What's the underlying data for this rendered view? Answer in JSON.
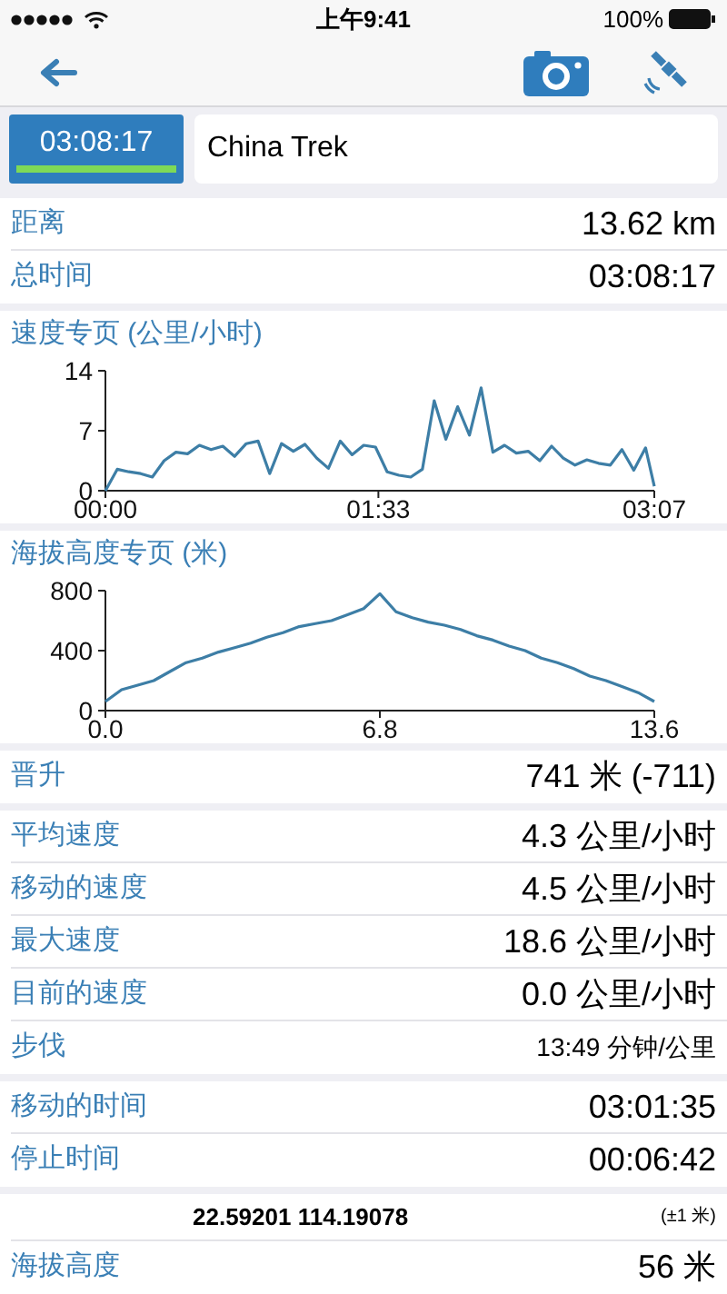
{
  "status_bar": {
    "time": "上午9:41",
    "battery": "100%"
  },
  "track": {
    "timer": "03:08:17",
    "name": "China Trek"
  },
  "summary": [
    {
      "label": "距离",
      "value": "13.62 km"
    },
    {
      "label": "总时间",
      "value": "03:08:17"
    }
  ],
  "speed_chart": {
    "title": "速度专页 (公里/小时)",
    "chart_data": {
      "type": "line",
      "x": [
        0,
        4,
        8,
        12,
        16,
        20,
        24,
        28,
        32,
        36,
        40,
        44,
        48,
        52,
        56,
        60,
        64,
        68,
        72,
        76,
        80,
        84,
        88,
        92,
        96,
        100,
        104,
        108,
        112,
        116,
        120,
        124,
        128,
        132,
        136,
        140,
        144,
        148,
        152,
        156,
        160,
        164,
        168,
        172,
        176,
        180,
        184,
        187
      ],
      "series": [
        {
          "color": "#3d7ea6",
          "values": [
            0,
            2.5,
            2.2,
            2,
            1.6,
            3.5,
            4.5,
            4.3,
            5.3,
            4.8,
            5.2,
            4,
            5.5,
            5.8,
            2,
            5.5,
            4.6,
            5.4,
            3.8,
            2.6,
            5.8,
            4.2,
            5.3,
            5.1,
            2.2,
            1.8,
            1.6,
            2.5,
            10.5,
            6,
            9.8,
            6.5,
            12,
            4.5,
            5.3,
            4.4,
            4.6,
            3.5,
            5.2,
            3.8,
            3,
            3.6,
            3.2,
            3,
            4.8,
            2.4,
            5,
            0.5
          ]
        }
      ],
      "xlim": [
        0,
        187
      ],
      "ylim": [
        0,
        14
      ],
      "xticks": [
        {
          "value": 0,
          "label": "00:00"
        },
        {
          "value": 93,
          "label": "01:33"
        },
        {
          "value": 187,
          "label": "03:07"
        }
      ],
      "yticks": [
        0,
        7,
        14
      ]
    }
  },
  "elevation_chart": {
    "title": "海拔高度专页 (米)",
    "chart_data": {
      "type": "line",
      "x": [
        0,
        0.4,
        0.8,
        1.2,
        1.6,
        2,
        2.4,
        2.8,
        3.2,
        3.6,
        4,
        4.4,
        4.8,
        5.2,
        5.6,
        6,
        6.4,
        6.8,
        7.2,
        7.6,
        8,
        8.4,
        8.8,
        9.2,
        9.6,
        10,
        10.4,
        10.8,
        11.2,
        11.6,
        12,
        12.4,
        12.8,
        13.2,
        13.6
      ],
      "series": [
        {
          "color": "#3d7ea6",
          "values": [
            60,
            140,
            170,
            200,
            260,
            320,
            350,
            390,
            420,
            450,
            490,
            520,
            560,
            580,
            600,
            640,
            680,
            780,
            660,
            620,
            590,
            570,
            540,
            500,
            470,
            430,
            400,
            350,
            320,
            280,
            230,
            200,
            160,
            120,
            60
          ]
        }
      ],
      "xlim": [
        0,
        13.6
      ],
      "ylim": [
        0,
        800
      ],
      "xticks": [
        {
          "value": 0,
          "label": "0.0"
        },
        {
          "value": 6.8,
          "label": "6.8"
        },
        {
          "value": 13.6,
          "label": "13.6"
        }
      ],
      "yticks": [
        0,
        400,
        800
      ]
    }
  },
  "ascent": [
    {
      "label": "晋升",
      "value": "741 米 (-711)"
    }
  ],
  "speeds": [
    {
      "label": "平均速度",
      "value": "4.3 公里/小时"
    },
    {
      "label": "移动的速度",
      "value": "4.5 公里/小时"
    },
    {
      "label": "最大速度",
      "value": "18.6 公里/小时"
    },
    {
      "label": "目前的速度",
      "value": "0.0 公里/小时"
    },
    {
      "label": "步伐",
      "value": "13:49 分钟/公里",
      "small": true
    }
  ],
  "times": [
    {
      "label": "移动的时间",
      "value": "03:01:35"
    },
    {
      "label": "停止时间",
      "value": "00:06:42"
    }
  ],
  "location": {
    "coordinates": "22.59201 114.19078",
    "accuracy": "(±1 米)",
    "altitude_label": "海拔高度",
    "altitude_value": "56 米"
  }
}
